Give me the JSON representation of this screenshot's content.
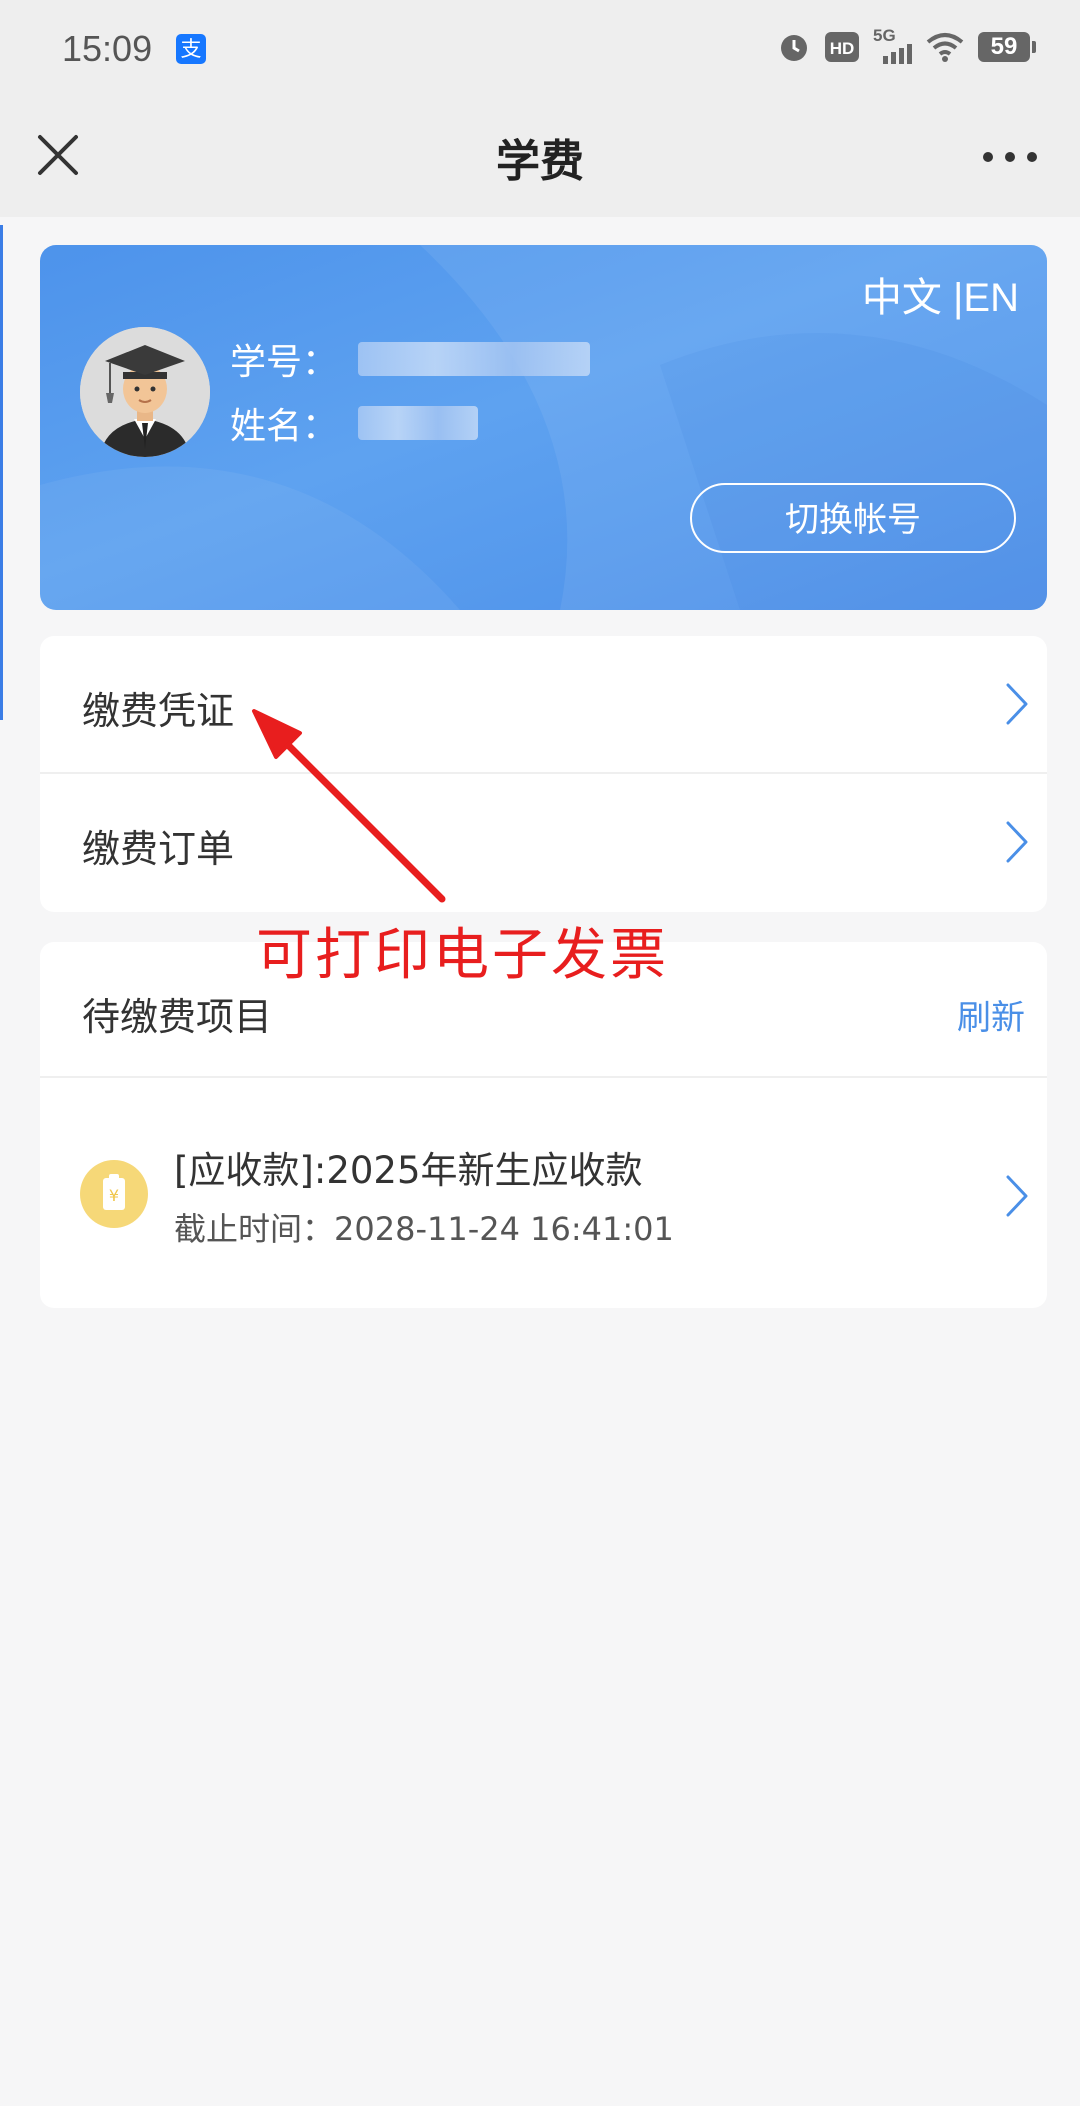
{
  "status_bar": {
    "time": "15:09",
    "app_badge_text": "支",
    "network_label": "5G",
    "battery_level": "59",
    "icons": [
      "alarm-icon",
      "hd-icon",
      "5g-signal-icon",
      "wifi-icon",
      "battery-icon"
    ]
  },
  "nav": {
    "title": "学费",
    "icons": [
      "close-icon",
      "more-icon"
    ]
  },
  "profile": {
    "lang_switch": "中文 |EN",
    "student_id_label": "学号：",
    "name_label": "姓名：",
    "switch_account": "切换帐号",
    "avatar_icon": "graduate-avatar-icon"
  },
  "menu": {
    "items": [
      {
        "label": "缴费凭证",
        "icon": "chevron-right-icon"
      },
      {
        "label": "缴费订单",
        "icon": "chevron-right-icon"
      }
    ]
  },
  "annotation": {
    "text": "可打印电子发票",
    "color": "#e81e1e"
  },
  "pending": {
    "title": "待缴费项目",
    "refresh": "刷新",
    "items": [
      {
        "title": "[应收款]:2025年新生应收款",
        "deadline": "截止时间：2028-11-24 16:41:01",
        "icon": "fee-tag-icon"
      }
    ]
  },
  "colors": {
    "accent": "#4a8fe7",
    "card_blue": "#5ea2f0",
    "fee_icon_bg": "#f6d878",
    "page_bg": "#f6f6f7"
  }
}
